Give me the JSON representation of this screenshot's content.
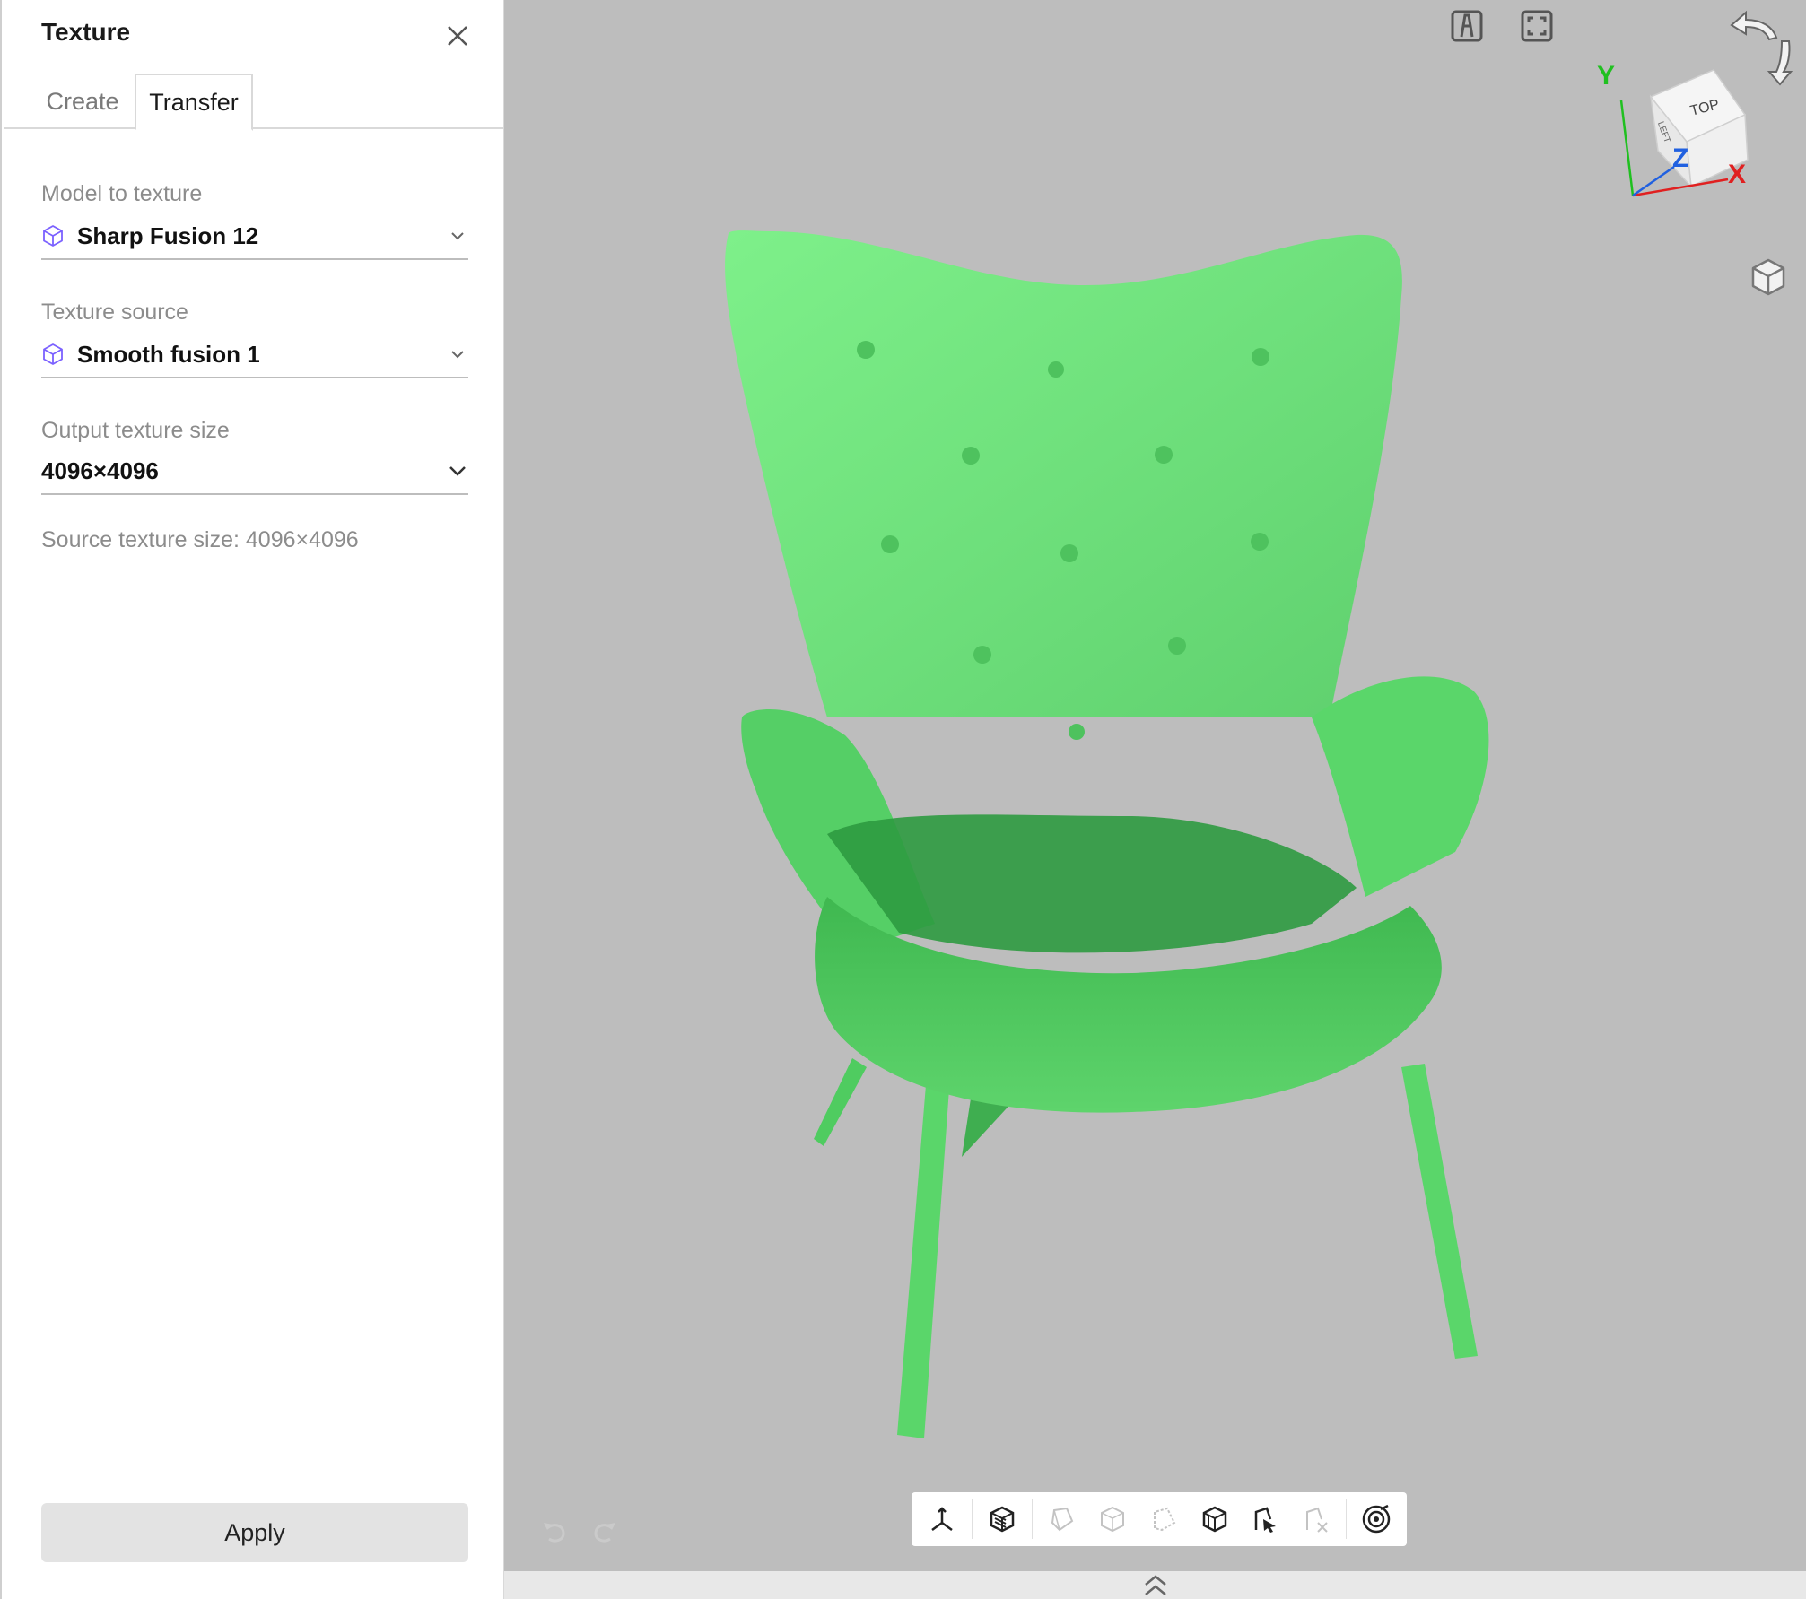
{
  "panel": {
    "title": "Texture",
    "tabs": [
      {
        "label": "Create",
        "active": false
      },
      {
        "label": "Transfer",
        "active": true
      }
    ],
    "model_to_texture": {
      "label": "Model to texture",
      "value": "Sharp Fusion 12"
    },
    "texture_source": {
      "label": "Texture source",
      "value": "Smooth fusion 1"
    },
    "output_texture_size": {
      "label": "Output texture size",
      "value": "4096×4096"
    },
    "source_texture_info": "Source texture size: 4096×4096",
    "apply_label": "Apply"
  },
  "viewport": {
    "background": "#bdbdbd",
    "model_color": "#6fe07f",
    "view_cube": {
      "top_label": "TOP",
      "left_label": "LEFT"
    },
    "axes": {
      "x": "X",
      "y": "Y",
      "z": "Z"
    },
    "toolbar_icons": [
      "move-axes-icon",
      "solid-box-icon",
      "box-face-icon",
      "box-side-icon",
      "box-edge-icon",
      "box-outline-icon",
      "model-pointer-icon",
      "model-pointer-disabled-icon",
      "target-icon"
    ]
  },
  "colors": {
    "accent_cube": "#7b61ff",
    "axis_x": "#e02020",
    "axis_y": "#20c020",
    "axis_z": "#2060e0"
  }
}
